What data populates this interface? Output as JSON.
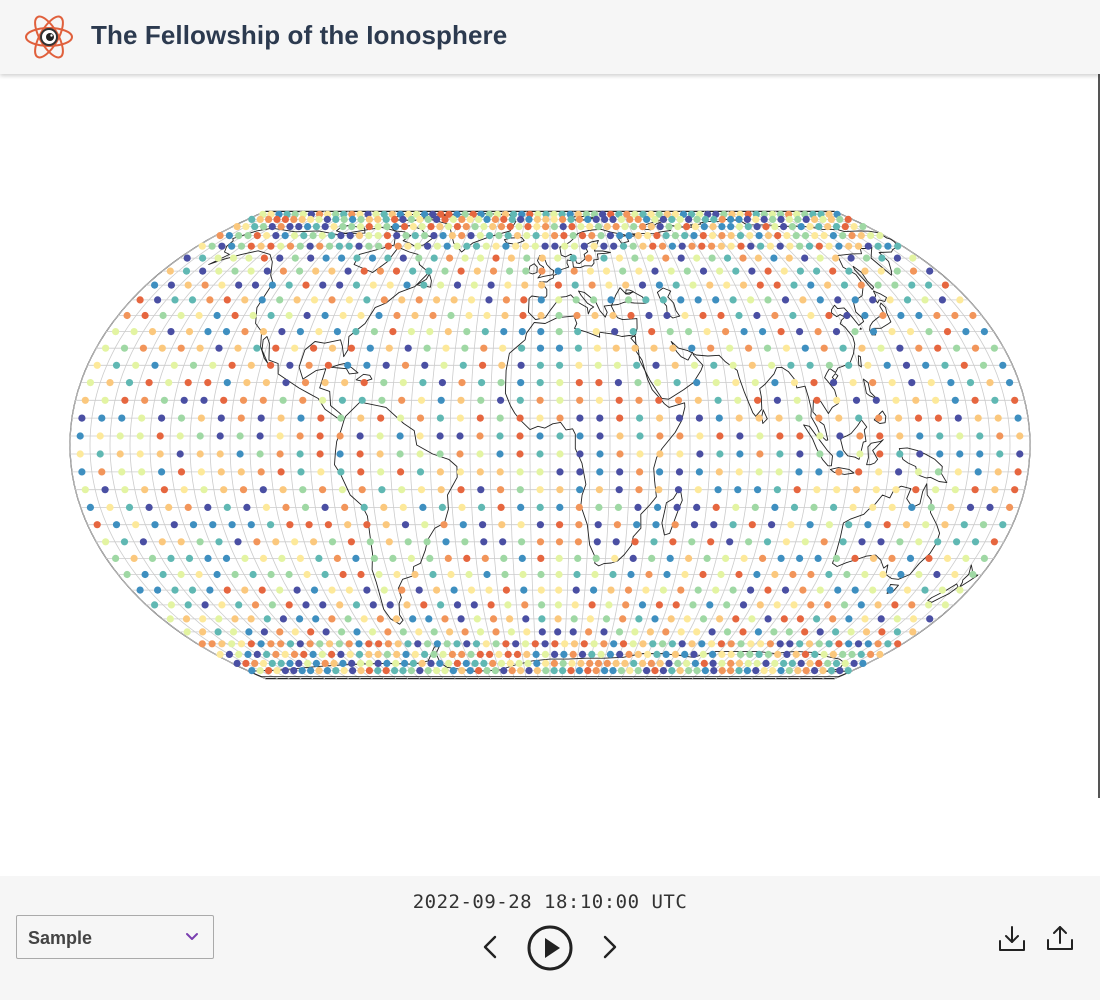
{
  "app": {
    "title": "The Fellowship of the Ionosphere",
    "logo_icon": "atom-eye-logo-icon"
  },
  "map": {
    "projection": "Equal Earth",
    "graticule_color": "#cccccc",
    "coastline_color": "#222222",
    "color_scale": [
      "#4a4fa3",
      "#3e8fc0",
      "#60b8b3",
      "#9fd8a4",
      "#e3f4a2",
      "#fde99a",
      "#fbc87d",
      "#f2955a",
      "#e6663f"
    ],
    "grid_lat_range": [
      -77.5,
      82.5
    ],
    "grid_lat_step": 5,
    "grid_lon_step": 7.5,
    "grid_lon_range": [
      -180,
      180
    ]
  },
  "controls": {
    "timestamp": "2022-09-28 18:10:00 UTC",
    "dataset_select": {
      "selected": "Sample",
      "icon": "chevron-down-icon"
    },
    "prev_icon": "chevron-left-icon",
    "play_icon": "play-circle-icon",
    "next_icon": "chevron-right-icon",
    "download_icon": "download-icon",
    "share_icon": "share-icon"
  }
}
